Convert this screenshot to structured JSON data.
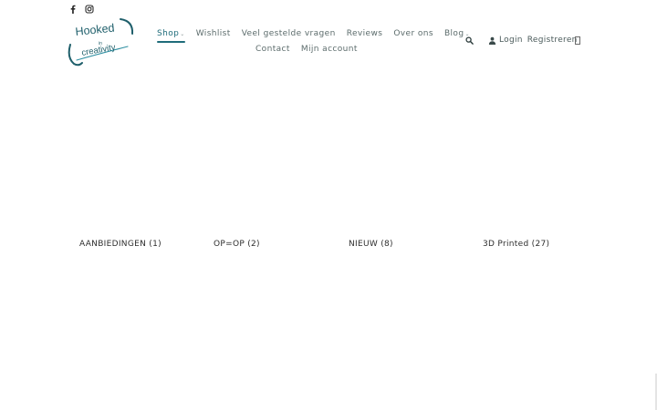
{
  "social": {
    "icons": [
      "facebook-icon",
      "instagram-icon"
    ]
  },
  "logo": {
    "line1": "Hooked",
    "line2": "in",
    "line3": "creativity",
    "color": "#1f5f6b",
    "accent": "#2f8fa1"
  },
  "nav": {
    "items": [
      {
        "label": "Shop",
        "has_dropdown": true,
        "active": true
      },
      {
        "label": "Wishlist"
      },
      {
        "label": "Veel gestelde vragen"
      },
      {
        "label": "Reviews"
      },
      {
        "label": "Over ons"
      },
      {
        "label": "Blog",
        "has_dropdown": true
      },
      {
        "label": "Contact"
      },
      {
        "label": "Mijn account"
      }
    ],
    "caret": "⌄",
    "active_color": "#1f6c7a"
  },
  "header": {
    "search_icon": "search-icon",
    "user_icon": "user-icon",
    "login_label": "Login",
    "register_label": "Registreren",
    "cart_icon": "cart-icon"
  },
  "categories": [
    {
      "label": "AANBIEDINGEN (1)"
    },
    {
      "label": "OP=OP (2)"
    },
    {
      "label": "NIEUW (8)"
    },
    {
      "label": "3D Printed (27)"
    }
  ]
}
